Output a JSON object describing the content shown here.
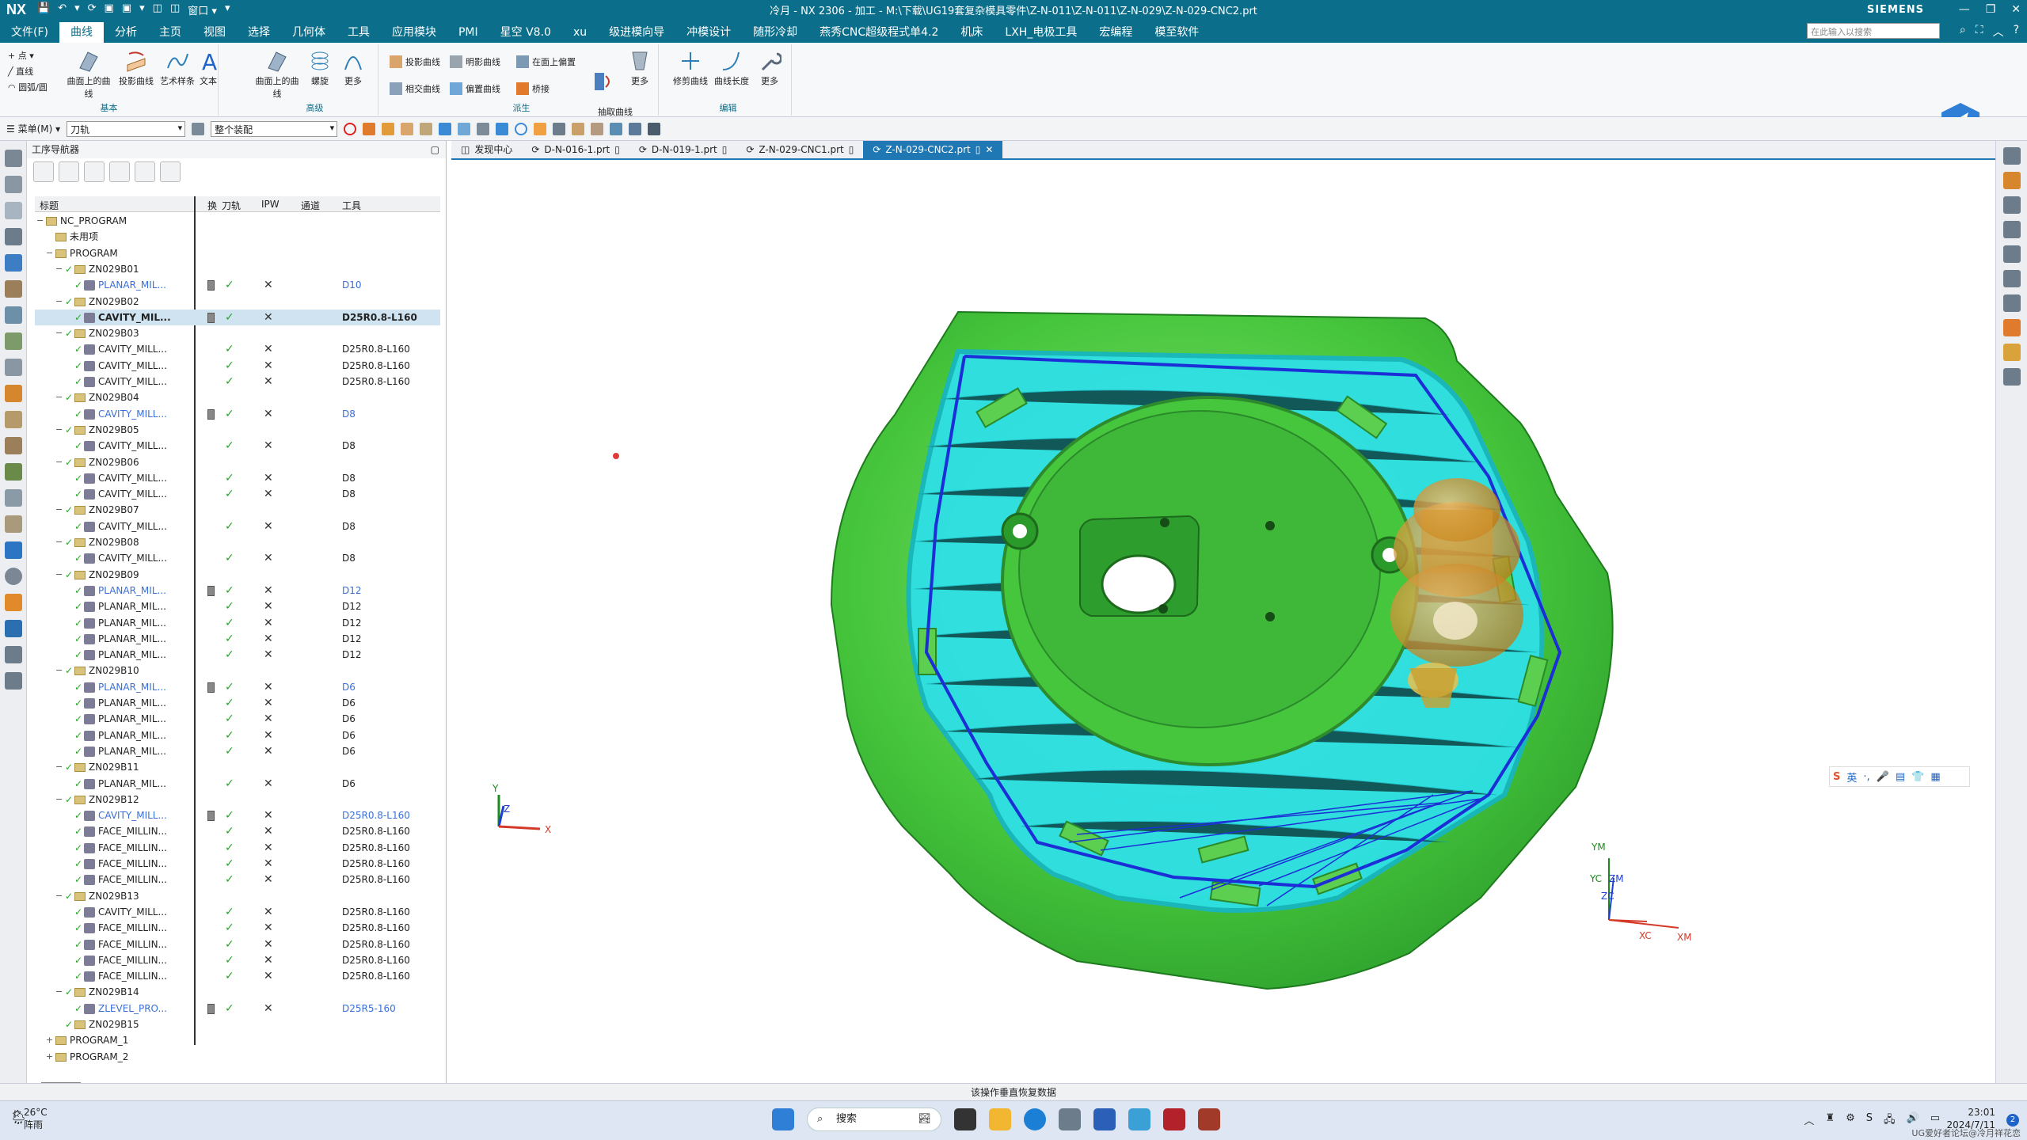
{
  "window": {
    "title": "冷月 - NX 2306 - 加工 - M:\\下载\\UG19套复杂模具零件\\Z-N-011\\Z-N-011\\Z-N-029\\Z-N-029-CNC2.prt",
    "brand": "SIEMENS",
    "logo": "NX",
    "quick_access": [
      "↶",
      "▾",
      "⟳",
      "▣",
      "▣",
      "▾",
      "◫",
      "◫",
      "窗口 ▾",
      "▾"
    ]
  },
  "menubar": {
    "items": [
      "文件(F)",
      "曲线",
      "分析",
      "主页",
      "视图",
      "选择",
      "几何体",
      "工具",
      "应用模块",
      "PMI",
      "星空 V8.0",
      "xu",
      "级进模向导",
      "冲模设计",
      "随形冷却",
      "燕秀CNC超级程式单4.2",
      "机床",
      "LXH_电极工具",
      "宏编程",
      "模至软件"
    ],
    "active_index": 1,
    "search_placeholder": "在此输入以搜索"
  },
  "ribbon": {
    "groups": [
      {
        "label": "基本",
        "small": [
          "+ 点 ▾",
          "╱ 直线",
          "◠ 圆弧/圆"
        ],
        "buttons": [
          "曲面上的曲线",
          "投影曲线",
          "艺术样条",
          "文本"
        ]
      },
      {
        "label": "高级",
        "buttons": [
          "曲面上的曲线",
          "螺旋",
          "更多"
        ]
      },
      {
        "label": "派生",
        "small": [
          "投影曲线",
          "相交曲线",
          "明影曲线",
          "偏置曲线",
          "在面上偏置",
          "桥接"
        ],
        "buttons": [
          "抽取曲线\n(原有)",
          "更多"
        ]
      },
      {
        "label": "编辑",
        "buttons": [
          "修剪曲线",
          "曲线长度",
          "更多"
        ]
      }
    ]
  },
  "selbar": {
    "menu_label": "☰ 菜单(M) ▾",
    "filter_value": "刀轨",
    "scope_value": "整个装配"
  },
  "navigator": {
    "title": "工序导航器",
    "columns": [
      "标题",
      "换",
      "刀轨",
      "IPW",
      "通道",
      "工具"
    ],
    "rows": [
      {
        "label": "NC_PROGRAM",
        "level": 0,
        "type": "root",
        "exp": "−"
      },
      {
        "label": "未用项",
        "level": 1,
        "type": "folder"
      },
      {
        "label": "PROGRAM",
        "level": 1,
        "type": "folder",
        "exp": "−"
      },
      {
        "label": "ZN029B01",
        "level": 2,
        "type": "group",
        "exp": "−"
      },
      {
        "label": "PLANAR_MIL...",
        "level": 3,
        "type": "op",
        "style": "blue",
        "chg": true,
        "tool": "D10",
        "tool_style": "blue"
      },
      {
        "label": "ZN029B02",
        "level": 2,
        "type": "group",
        "exp": "−"
      },
      {
        "label": "CAVITY_MIL...",
        "level": 3,
        "type": "op",
        "style": "bold",
        "chg": true,
        "tool": "D25R0.8-L160",
        "tool_style": "bold",
        "selected": true
      },
      {
        "label": "ZN029B03",
        "level": 2,
        "type": "group",
        "exp": "−"
      },
      {
        "label": "CAVITY_MILL...",
        "level": 3,
        "type": "op",
        "tool": "D25R0.8-L160"
      },
      {
        "label": "CAVITY_MILL...",
        "level": 3,
        "type": "op",
        "tool": "D25R0.8-L160"
      },
      {
        "label": "CAVITY_MILL...",
        "level": 3,
        "type": "op",
        "tool": "D25R0.8-L160"
      },
      {
        "label": "ZN029B04",
        "level": 2,
        "type": "group",
        "exp": "−"
      },
      {
        "label": "CAVITY_MILL...",
        "level": 3,
        "type": "op",
        "style": "blue",
        "chg": true,
        "tool": "D8",
        "tool_style": "blue"
      },
      {
        "label": "ZN029B05",
        "level": 2,
        "type": "group",
        "exp": "−"
      },
      {
        "label": "CAVITY_MILL...",
        "level": 3,
        "type": "op",
        "tool": "D8"
      },
      {
        "label": "ZN029B06",
        "level": 2,
        "type": "group",
        "exp": "−"
      },
      {
        "label": "CAVITY_MILL...",
        "level": 3,
        "type": "op",
        "tool": "D8"
      },
      {
        "label": "CAVITY_MILL...",
        "level": 3,
        "type": "op",
        "tool": "D8"
      },
      {
        "label": "ZN029B07",
        "level": 2,
        "type": "group",
        "exp": "−"
      },
      {
        "label": "CAVITY_MILL...",
        "level": 3,
        "type": "op",
        "tool": "D8"
      },
      {
        "label": "ZN029B08",
        "level": 2,
        "type": "group",
        "exp": "−"
      },
      {
        "label": "CAVITY_MILL...",
        "level": 3,
        "type": "op",
        "tool": "D8"
      },
      {
        "label": "ZN029B09",
        "level": 2,
        "type": "group",
        "exp": "−"
      },
      {
        "label": "PLANAR_MIL...",
        "level": 3,
        "type": "op",
        "style": "blue",
        "chg": true,
        "tool": "D12",
        "tool_style": "blue"
      },
      {
        "label": "PLANAR_MIL...",
        "level": 3,
        "type": "op",
        "tool": "D12"
      },
      {
        "label": "PLANAR_MIL...",
        "level": 3,
        "type": "op",
        "tool": "D12"
      },
      {
        "label": "PLANAR_MIL...",
        "level": 3,
        "type": "op",
        "tool": "D12"
      },
      {
        "label": "PLANAR_MIL...",
        "level": 3,
        "type": "op",
        "tool": "D12"
      },
      {
        "label": "ZN029B10",
        "level": 2,
        "type": "group",
        "exp": "−"
      },
      {
        "label": "PLANAR_MIL...",
        "level": 3,
        "type": "op",
        "style": "blue",
        "chg": true,
        "tool": "D6",
        "tool_style": "blue"
      },
      {
        "label": "PLANAR_MIL...",
        "level": 3,
        "type": "op",
        "tool": "D6"
      },
      {
        "label": "PLANAR_MIL...",
        "level": 3,
        "type": "op",
        "tool": "D6"
      },
      {
        "label": "PLANAR_MIL...",
        "level": 3,
        "type": "op",
        "tool": "D6"
      },
      {
        "label": "PLANAR_MIL...",
        "level": 3,
        "type": "op",
        "tool": "D6"
      },
      {
        "label": "ZN029B11",
        "level": 2,
        "type": "group",
        "exp": "−"
      },
      {
        "label": "PLANAR_MIL...",
        "level": 3,
        "type": "op",
        "tool": "D6"
      },
      {
        "label": "ZN029B12",
        "level": 2,
        "type": "group",
        "exp": "−"
      },
      {
        "label": "CAVITY_MILL...",
        "level": 3,
        "type": "op",
        "style": "blue",
        "chg": true,
        "tool": "D25R0.8-L160",
        "tool_style": "blue"
      },
      {
        "label": "FACE_MILLIN...",
        "level": 3,
        "type": "op",
        "tool": "D25R0.8-L160"
      },
      {
        "label": "FACE_MILLIN...",
        "level": 3,
        "type": "op",
        "tool": "D25R0.8-L160"
      },
      {
        "label": "FACE_MILLIN...",
        "level": 3,
        "type": "op",
        "tool": "D25R0.8-L160"
      },
      {
        "label": "FACE_MILLIN...",
        "level": 3,
        "type": "op",
        "tool": "D25R0.8-L160"
      },
      {
        "label": "ZN029B13",
        "level": 2,
        "type": "group",
        "exp": "−"
      },
      {
        "label": "CAVITY_MILL...",
        "level": 3,
        "type": "op",
        "tool": "D25R0.8-L160"
      },
      {
        "label": "FACE_MILLIN...",
        "level": 3,
        "type": "op",
        "tool": "D25R0.8-L160"
      },
      {
        "label": "FACE_MILLIN...",
        "level": 3,
        "type": "op",
        "tool": "D25R0.8-L160"
      },
      {
        "label": "FACE_MILLIN...",
        "level": 3,
        "type": "op",
        "tool": "D25R0.8-L160"
      },
      {
        "label": "FACE_MILLIN...",
        "level": 3,
        "type": "op",
        "tool": "D25R0.8-L160"
      },
      {
        "label": "ZN029B14",
        "level": 2,
        "type": "group",
        "exp": "−"
      },
      {
        "label": "ZLEVEL_PRO...",
        "level": 3,
        "type": "op",
        "style": "blue",
        "chg": true,
        "tool": "D25R5-160",
        "tool_style": "blue"
      },
      {
        "label": "ZN029B15",
        "level": 2,
        "type": "group"
      },
      {
        "label": "PROGRAM_1",
        "level": 1,
        "type": "folder",
        "exp": "+"
      },
      {
        "label": "PROGRAM_2",
        "level": 1,
        "type": "folder",
        "exp": "+"
      }
    ]
  },
  "tabs": [
    {
      "label": "发现中心",
      "active": false
    },
    {
      "label": "D-N-016-1.prt",
      "active": false
    },
    {
      "label": "D-N-019-1.prt",
      "active": false
    },
    {
      "label": "Z-N-029-CNC1.prt",
      "active": false
    },
    {
      "label": "Z-N-029-CNC2.prt",
      "active": true
    }
  ],
  "viewport": {
    "triad_small": {
      "y": "Y",
      "z": "Z",
      "x": "X"
    },
    "triad_large": {
      "ym": "YM",
      "yc": "YC",
      "zm": "ZM",
      "zc": "ZC",
      "xc": "XC",
      "xm": "XM"
    },
    "colors": {
      "part": "#3ec63a",
      "toolpath": "#2ee0e6",
      "path_line": "#1c2fd6",
      "tool": "#d08820"
    }
  },
  "ime": {
    "items": [
      "S",
      "英",
      "·,",
      "🎤",
      "▤",
      "👕",
      "▦"
    ]
  },
  "status": {
    "message": "该操作垂直恢复数据"
  },
  "taskbar": {
    "weather_temp": "26°C",
    "weather_desc": "阵雨",
    "search_label": "搜索",
    "time": "23:01",
    "date": "2024/7/11",
    "badge": "2",
    "watermark": "UG爱好者论坛@冷月祥花恋"
  }
}
